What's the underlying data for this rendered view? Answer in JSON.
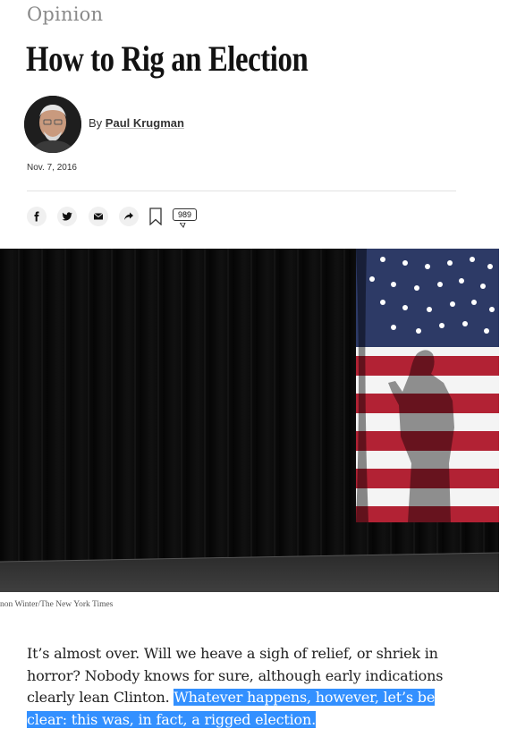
{
  "article": {
    "section": "Opinion",
    "headline": "How to Rig an Election",
    "byline_prefix": "By ",
    "author": "Paul Krugman",
    "date": "Nov. 7, 2016",
    "comment_count": "989",
    "photo_credit": "non Winter/The New York Times",
    "paragraph_plain": "It’s almost over. Will we heave a sigh of relief, or shriek in horror? Nobody knows for sure, although early indications clearly lean Clinton. ",
    "paragraph_selected": "Whatever happens, however, let’s be clear: this was, in fact, a rigged election."
  },
  "share_icons": [
    "facebook-icon",
    "twitter-icon",
    "email-icon",
    "share-arrow-icon",
    "bookmark-icon",
    "comment-icon"
  ],
  "colors": {
    "selection": "#3390ff",
    "flag_red": "#b22234",
    "flag_blue": "#3c3b6e"
  }
}
